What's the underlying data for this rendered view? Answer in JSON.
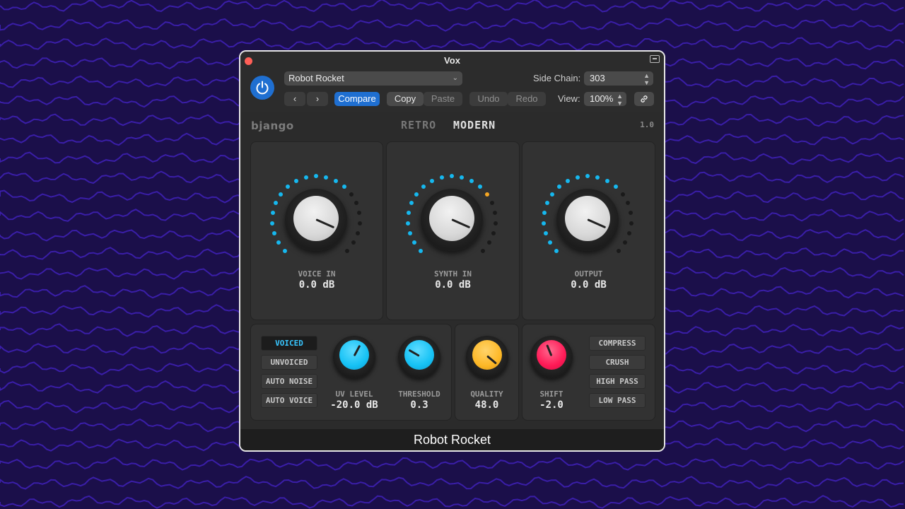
{
  "window": {
    "title": "Vox",
    "footer_title": "Robot Rocket"
  },
  "header": {
    "preset": "Robot Rocket",
    "side_chain_label": "Side Chain:",
    "side_chain_value": "303",
    "compare_label": "Compare",
    "copy_label": "Copy",
    "paste_label": "Paste",
    "undo_label": "Undo",
    "redo_label": "Redo",
    "view_label": "View:",
    "view_value": "100%"
  },
  "plugin": {
    "brand": "bjango",
    "version": "1.0",
    "modes": [
      "RETRO",
      "MODERN"
    ],
    "active_mode": "MODERN",
    "main_knobs": [
      {
        "label": "VOICE IN",
        "value": "0.0 dB"
      },
      {
        "label": "SYNTH IN",
        "value": "0.0 dB"
      },
      {
        "label": "OUTPUT",
        "value": "0.0 dB"
      }
    ],
    "voice_buttons": [
      "VOICED",
      "UNVOICED",
      "AUTO NOISE",
      "AUTO VOICE"
    ],
    "active_voice_button": "VOICED",
    "small_knobs": [
      {
        "label": "UV LEVEL",
        "value": "-20.0 dB",
        "color": "#16c2f5"
      },
      {
        "label": "THRESHOLD",
        "value": "0.3",
        "color": "#16c2f5"
      },
      {
        "label": "QUALITY",
        "value": "48.0",
        "color": "#fdb827"
      },
      {
        "label": "SHIFT",
        "value": "-2.0",
        "color": "#ff1a56"
      }
    ],
    "effect_buttons": [
      "COMPRESS",
      "CRUSH",
      "HIGH PASS",
      "LOW PASS"
    ]
  },
  "colors": {
    "accent": "#1f6fd1",
    "meter_on": "#16b8ef",
    "meter_peak": "#f5a623",
    "meter_off": "#1a1a1a",
    "background": "#1b0f4a"
  }
}
